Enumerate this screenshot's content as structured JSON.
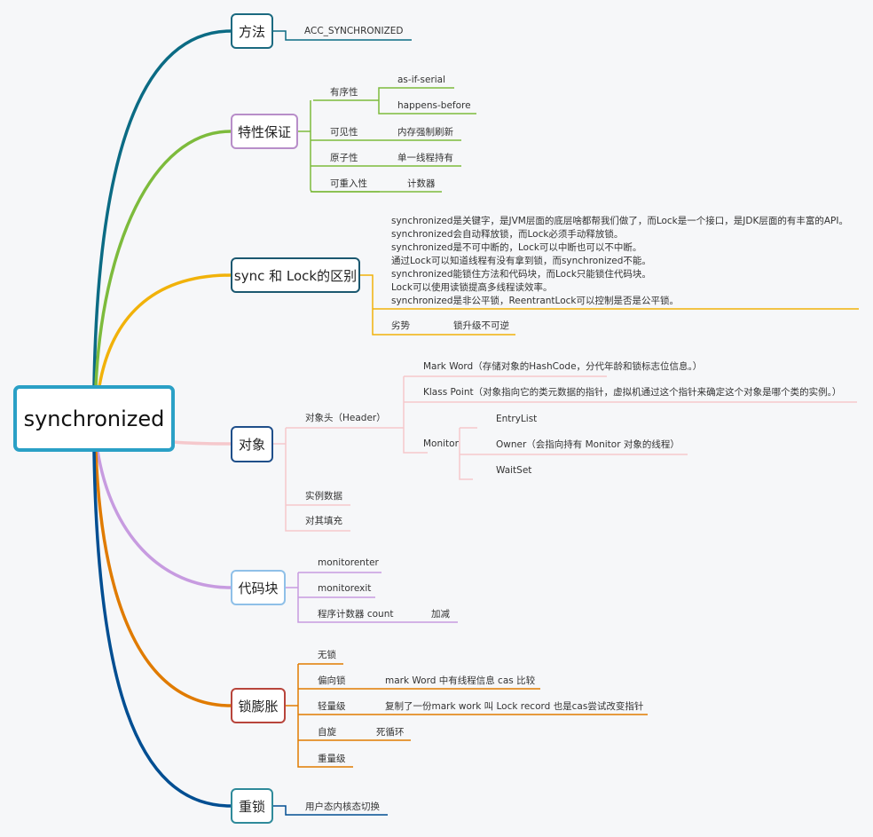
{
  "root": {
    "label": "synchronized"
  },
  "colors": {
    "method": "#0b6b84",
    "features": "#7dbb3c",
    "diff": "#f1b20a",
    "object": "#f5c8cc",
    "codeblock": "#c79be0",
    "inflation": "#e07b00",
    "heavy": "#004e92"
  },
  "branches": {
    "method": {
      "label": "方法",
      "children": [
        "ACC_SYNCHRONIZED"
      ]
    },
    "features": {
      "label": "特性保证",
      "ordering": {
        "label": "有序性",
        "children": [
          "as-if-serial",
          "happens-before"
        ]
      },
      "visibility": {
        "label": "可见性",
        "child": "内存强制刷新"
      },
      "atomicity": {
        "label": "原子性",
        "child": "单一线程持有"
      },
      "reentrancy": {
        "label": "可重入性",
        "child": "计数器"
      }
    },
    "diff": {
      "label": "sync 和 Lock的区别",
      "lines": [
        "synchronized是关键字，是JVM层面的底层啥都帮我们做了，而Lock是一个接口，是JDK层面的有丰富的API。",
        "synchronized会自动释放锁，而Lock必须手动释放锁。",
        "synchronized是不可中断的，Lock可以中断也可以不中断。",
        "通过Lock可以知道线程有没有拿到锁，而synchronized不能。",
        "synchronized能锁住方法和代码块，而Lock只能锁住代码块。",
        "Lock可以使用读锁提高多线程读效率。",
        "synchronized是非公平锁，ReentrantLock可以控制是否是公平锁。"
      ],
      "weakness": {
        "label": "劣势",
        "child": "锁升级不可逆"
      }
    },
    "object": {
      "label": "对象",
      "header": {
        "label": "对象头（Header）",
        "mark_word": "Mark Word（存储对象的HashCode，分代年龄和锁标志位信息。）",
        "klass_point": "Klass Point（对象指向它的类元数据的指针，虚拟机通过这个指针来确定这个对象是哪个类的实例。）",
        "monitor": {
          "label": "Monitor",
          "children": [
            "EntryList",
            "Owner（会指向持有 Monitor 对象的线程）",
            "WaitSet"
          ]
        }
      },
      "instance_data": "实例数据",
      "padding": "对其填充"
    },
    "codeblock": {
      "label": "代码块",
      "children": [
        "monitorenter",
        "monitorexit"
      ],
      "counter": {
        "label": "程序计数器 count",
        "child": "加减"
      }
    },
    "inflation": {
      "label": "锁膨胀",
      "no_lock": "无锁",
      "biased": {
        "label": "偏向锁",
        "child": "mark Word 中有线程信息 cas 比较"
      },
      "lightweight": {
        "label": "轻量级",
        "child": "复制了一份mark work 叫 Lock record 也是cas尝试改变指针"
      },
      "spin": {
        "label": "自旋",
        "child": "死循环"
      },
      "heavyweight": "重量级"
    },
    "heavy_lock": {
      "label": "重锁",
      "child": "用户态内核态切换"
    }
  }
}
